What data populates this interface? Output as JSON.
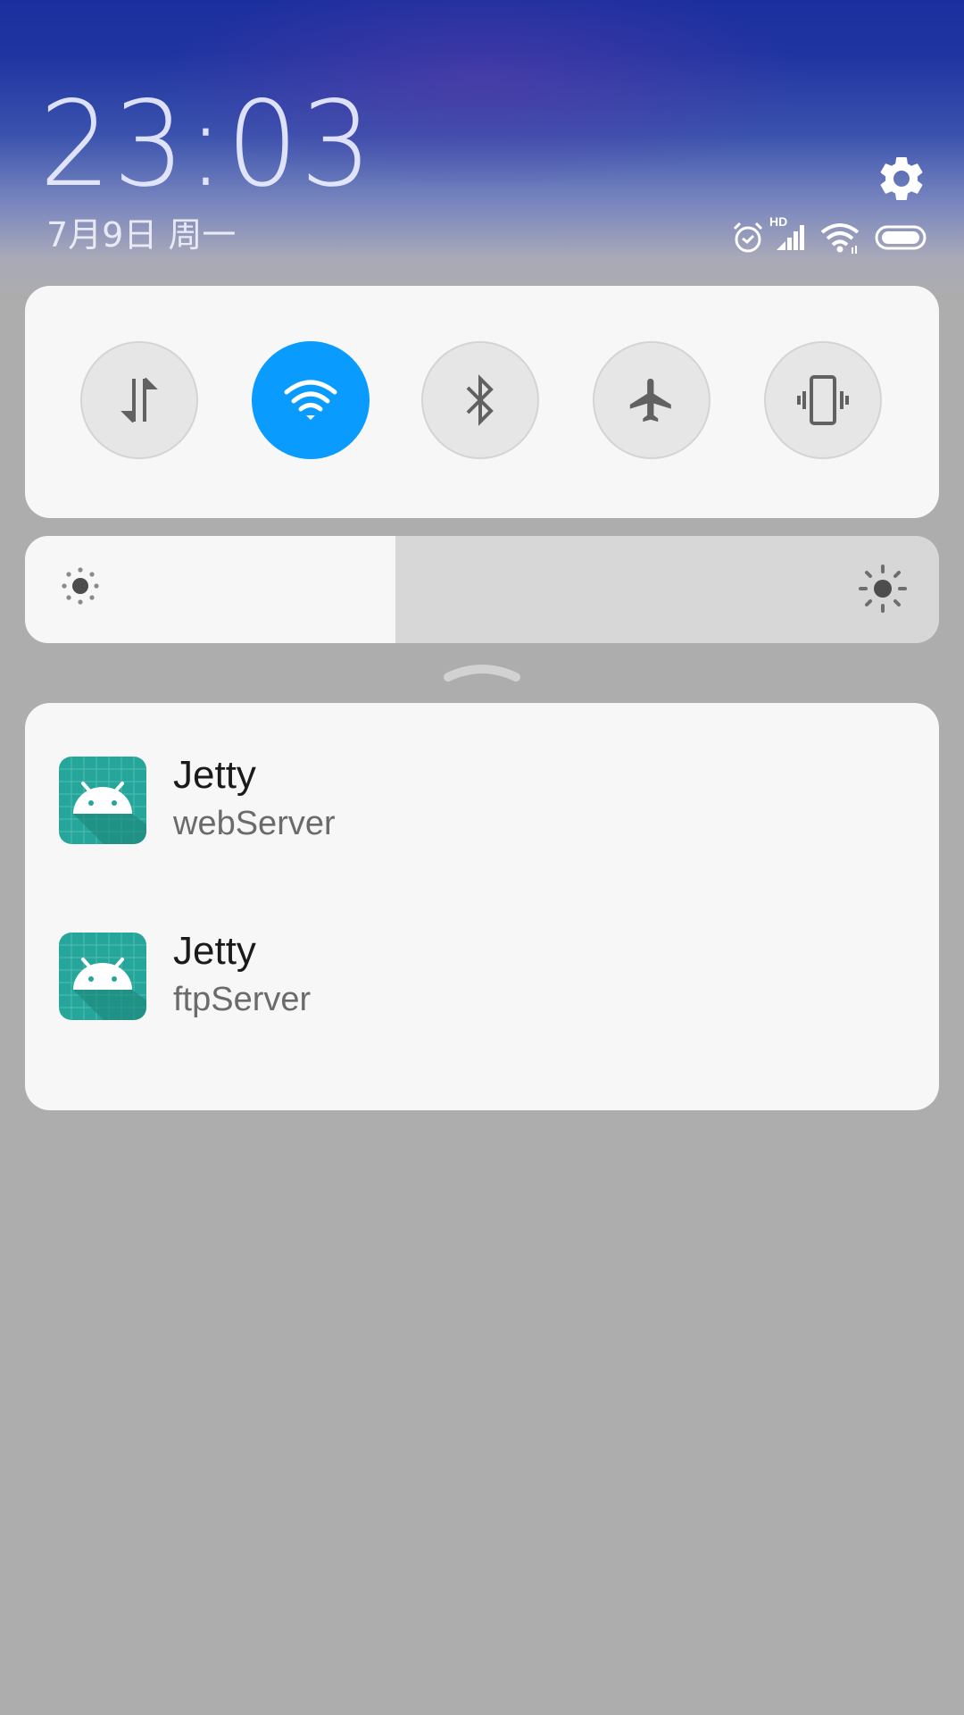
{
  "header": {
    "time": "23:03",
    "date": "7月9日 周一"
  },
  "status_icons": [
    "alarm-icon",
    "hd-signal-icon",
    "wifi-icon",
    "battery-icon"
  ],
  "status_text": {
    "hd": "HD"
  },
  "quick_toggles": [
    {
      "name": "mobile-data",
      "icon": "data-arrows-icon",
      "active": false
    },
    {
      "name": "wifi",
      "icon": "wifi-icon",
      "active": true
    },
    {
      "name": "bluetooth",
      "icon": "bluetooth-icon",
      "active": false
    },
    {
      "name": "airplane-mode",
      "icon": "airplane-icon",
      "active": false
    },
    {
      "name": "vibrate",
      "icon": "vibrate-icon",
      "active": false
    }
  ],
  "brightness": {
    "level": 0.405
  },
  "notifications": [
    {
      "title": "Jetty",
      "subtitle": "webServer"
    },
    {
      "title": "Jetty",
      "subtitle": "ftpServer"
    }
  ],
  "colors": {
    "accent": "#0a9bff",
    "app_icon": "#26a69a"
  }
}
